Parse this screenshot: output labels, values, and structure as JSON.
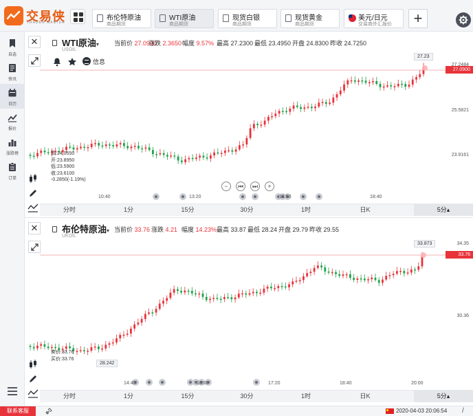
{
  "app": {
    "brand_name": "交易侠",
    "brand_sub": "TRADER MASTER"
  },
  "tabs": [
    {
      "name": "布伦特原油",
      "sub": "商品期货"
    },
    {
      "name": "WTI原油",
      "sub": "商品期货"
    },
    {
      "name": "现货白银",
      "sub": "商品期货"
    },
    {
      "name": "现货黄金",
      "sub": "商品期货"
    },
    {
      "name": "美元/日元",
      "sub": "交易商外汇报价"
    }
  ],
  "add_tab_label": "+",
  "sidebar": {
    "items": [
      {
        "label": "自选",
        "icon": "bookmark-icon"
      },
      {
        "label": "快讯",
        "icon": "news-icon"
      },
      {
        "label": "日历",
        "icon": "calendar-icon"
      },
      {
        "label": "报价",
        "icon": "trend-icon"
      },
      {
        "label": "涨跌榜",
        "icon": "bar-chart-icon"
      },
      {
        "label": "订单",
        "icon": "order-icon"
      }
    ]
  },
  "panels": [
    {
      "symbol": "WTI原油",
      "code": "USOIL",
      "caret": "▾",
      "quote": {
        "cur_label": "当前价",
        "cur_value": "27.0900",
        "chg_label": "涨跌",
        "chg_value": "2.3650",
        "pct_label": "幅度",
        "pct_value": "9.57%",
        "high_label": "最高",
        "high_value": "27.2300",
        "low_label": "最低",
        "low_value": "23.4950",
        "open_label": "开盘",
        "open_value": "24.8300",
        "prev_label": "昨收",
        "prev_value": "24.7250"
      },
      "info_label": "信息",
      "ohlc": [
        "高:24.0550",
        "开:23.8950",
        "低:23.5900",
        "收:23.6100",
        "-0.2850(-1.19%)"
      ],
      "price_axis": [
        "27.2484",
        "25.5821",
        "23.9161"
      ],
      "last_price_tag": "27.0900",
      "high_box": "27.23",
      "time_axis": [
        "10:40",
        "13:20",
        "16:00",
        "18:40"
      ]
    },
    {
      "symbol": "布伦特原油",
      "code": "UKOIL",
      "caret": "▾",
      "quote": {
        "cur_label": "当前价",
        "cur_value": "33.76",
        "chg_label": "涨跌",
        "chg_value": "4.21",
        "pct_label": "幅度",
        "pct_value": "14.23%",
        "high_label": "最高",
        "high_value": "33.87",
        "low_label": "最低",
        "low_value": "28.24",
        "open_label": "开盘",
        "open_value": "29.79",
        "prev_label": "昨收",
        "prev_value": "29.55"
      },
      "ohlc": [
        "卖价:33.76",
        "买价:33.76"
      ],
      "price_axis": [
        "34.35",
        "30.36"
      ],
      "last_price_tag": "33.76",
      "high_box": "33.873",
      "low_box": "28.242",
      "time_axis": [
        "14:40",
        "16:00",
        "17:20",
        "18:40",
        "20:00"
      ]
    }
  ],
  "periods": [
    "分时",
    "1分",
    "15分",
    "30分",
    "1时",
    "日K",
    "5分"
  ],
  "active_period_caret": "▴",
  "status": {
    "support_label": "联系客服",
    "clock": "2020-04-03 20:06:54"
  },
  "colors": {
    "up": "#e8333a",
    "down": "#1ea34a",
    "brand": "#f26b1d"
  }
}
